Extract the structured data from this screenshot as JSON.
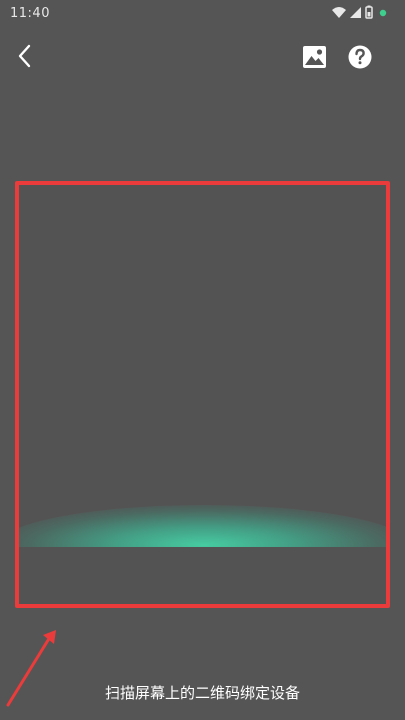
{
  "status_bar": {
    "time": "11:40"
  },
  "toolbar": {
    "back_icon": "chevron-left-icon",
    "gallery_icon": "image-icon",
    "help_icon": "question-circle-icon"
  },
  "scanner": {
    "frame_color": "#ec3b3b",
    "glow_color": "#46d2a5"
  },
  "hint": {
    "text": "扫描屏幕上的二维码绑定设备"
  }
}
